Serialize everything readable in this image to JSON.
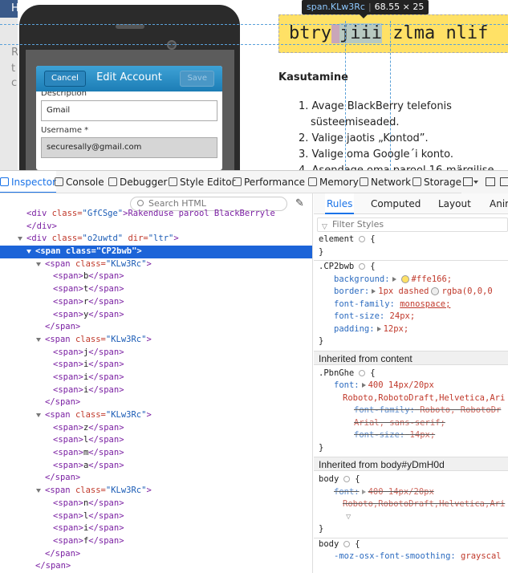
{
  "webpage": {
    "tooltip": {
      "selector": "span.KLw3Rc",
      "dims": "68.55 × 25"
    },
    "highlight": {
      "text_before": "btry",
      "text_hl": "jiii",
      "text_after": " zlma nlif"
    },
    "section_title": "Kasutamine",
    "steps": [
      "1. Avage BlackBerry telefonis",
      "    süsteemiseaded.",
      "2. Valige jaotis „Kontod”.",
      "3. Valige oma Google´i konto.",
      "4. Asendage oma parool 16-märgilise"
    ],
    "left_letters": [
      "H",
      "R",
      "t",
      "c"
    ],
    "phone": {
      "cancel": "Cancel",
      "title": "Edit Account",
      "save": "Save",
      "desc_label": "Description",
      "desc_value": "Gmail",
      "user_label": "Username *",
      "user_value": "securesally@gmail.com"
    }
  },
  "devtools": {
    "tabs": [
      "Inspector",
      "Console",
      "Debugger",
      "Style Editor",
      "Performance",
      "Memory",
      "Network",
      "Storage"
    ],
    "search_placeholder": "Search HTML",
    "subtabs": [
      "Rules",
      "Computed",
      "Layout",
      "Animations"
    ],
    "filter_placeholder": "Filter Styles",
    "markup": {
      "line0": {
        "pre": "<div ",
        "attr": "class=",
        "val": "\"GfCSge\"",
        "post": ">Rakenduse parool BlackBerryle"
      },
      "line1": "</div>",
      "line2": {
        "tag": "<div ",
        "a1": "class=",
        "v1": "\"o2uwtd\"",
        "a2": " dir=",
        "v2": "\"ltr\"",
        "end": ">"
      },
      "selected": "<span class=\"CP2bwb\">",
      "inner_span": {
        "tag": "<span ",
        "attr": "class=",
        "val": "\"KLw3Rc\"",
        "end": ">"
      },
      "groups": [
        [
          "b",
          "t",
          "r",
          "y"
        ],
        [
          "j",
          "i",
          "i",
          "i"
        ],
        [
          "z",
          "l",
          "m",
          "a"
        ],
        [
          "n",
          "l",
          "i",
          "f"
        ]
      ],
      "span_open": "<span>",
      "span_close": "</span>",
      "close_span": "</span>"
    },
    "rules": {
      "element": "element",
      "brace_open": "{",
      "brace_close": "}",
      "cp2bwb_sel": ".CP2bwb",
      "cp2bwb_decls": [
        {
          "prop": "background:",
          "val": "#ffe166;"
        },
        {
          "prop": "border:",
          "val": "1px dashed",
          "extra": "rgba(0,0,0"
        },
        {
          "prop": "font-family:",
          "val": "monospace;"
        },
        {
          "prop": "font-size:",
          "val": "24px;"
        },
        {
          "prop": "padding:",
          "val": "12px;"
        }
      ],
      "inherited_content": "Inherited from content",
      "pbnghe_sel": ".PbnGhe",
      "pbnghe_font": {
        "prop": "font:",
        "val": "400 14px/20px"
      },
      "pbnghe_font2": "Roboto,RobotoDraft,Helvetica,Ari",
      "pbnghe_ff": {
        "prop": "font-family:",
        "val": "Roboto, RobotoDr"
      },
      "pbnghe_ff2": "Arial, sans-serif;",
      "pbnghe_fs": {
        "prop": "font-size:",
        "val": "14px;"
      },
      "inherited_body": "Inherited from body#yDmH0d",
      "body_sel": "body",
      "body_font": {
        "prop": "font:",
        "val": "400 14px/20px"
      },
      "body_font2": "Roboto,RobotoDraft,Helvetica,Ari",
      "body2_decl": {
        "prop": "-moz-osx-font-smoothing:",
        "val": "grayscal"
      }
    },
    "colors": {
      "selected": "#1c64d8",
      "highlight_bg": "#ffe166",
      "tab_accent": "#1a73e8"
    }
  }
}
